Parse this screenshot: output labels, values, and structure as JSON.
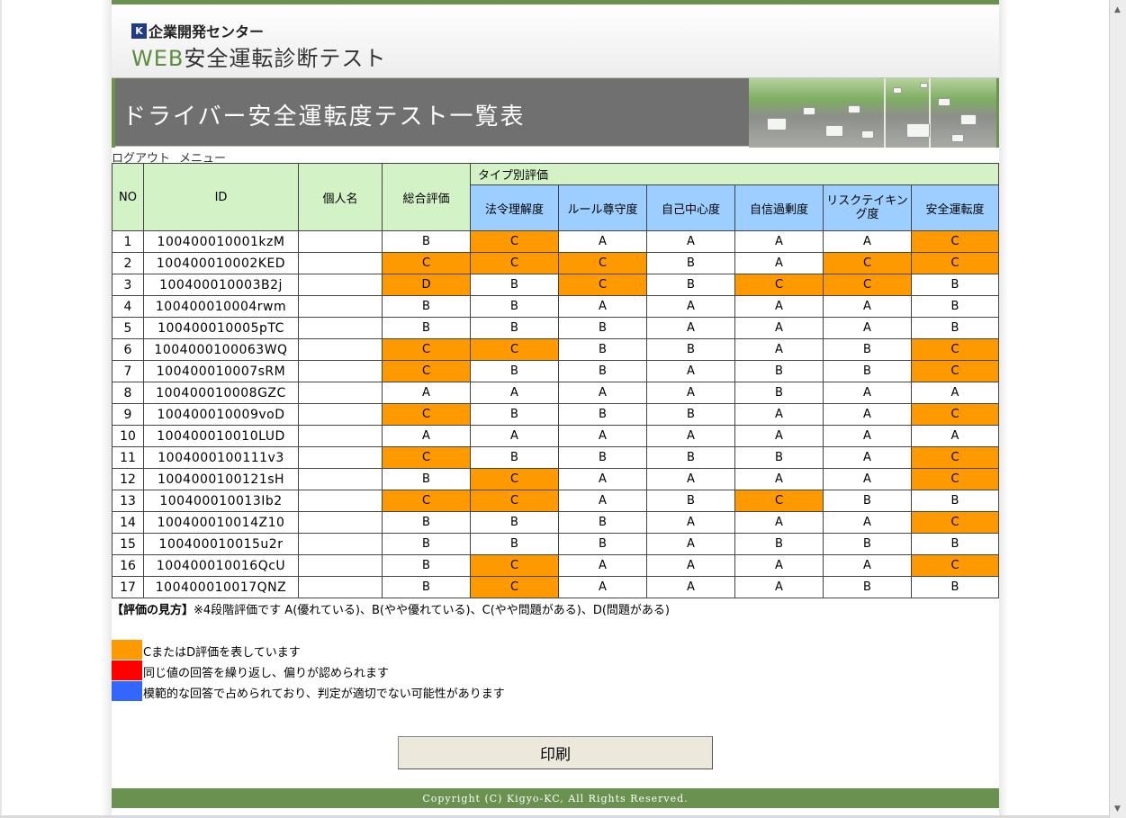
{
  "header": {
    "company": "企業開発センター",
    "logo_mark": "K",
    "app_title_web": "WEB",
    "app_title_rest": "安全運転診断テスト"
  },
  "banner": {
    "title": "ドライバー安全運転度テスト一覧表"
  },
  "links": {
    "logout": "ログアウト",
    "menu": "メニュー"
  },
  "table": {
    "headers": {
      "no": "NO",
      "id": "ID",
      "name": "個人名",
      "overall": "総合評価",
      "type_group": "タイプ別評価",
      "types": [
        "法令理解度",
        "ルール尊守度",
        "自己中心度",
        "自信過剰度",
        "リスクテイキング度",
        "安全運転度"
      ]
    },
    "rows": [
      {
        "no": "1",
        "id": "100400010001kzM",
        "name": "",
        "overall": "B",
        "types": [
          "C",
          "A",
          "A",
          "A",
          "A",
          "C"
        ]
      },
      {
        "no": "2",
        "id": "100400010002KED",
        "name": "",
        "overall": "C",
        "types": [
          "C",
          "C",
          "B",
          "A",
          "C",
          "C"
        ]
      },
      {
        "no": "3",
        "id": "100400010003B2j",
        "name": "",
        "overall": "D",
        "types": [
          "B",
          "C",
          "B",
          "C",
          "C",
          "B"
        ]
      },
      {
        "no": "4",
        "id": "100400010004rwm",
        "name": "",
        "overall": "B",
        "types": [
          "B",
          "A",
          "A",
          "A",
          "A",
          "B"
        ]
      },
      {
        "no": "5",
        "id": "100400010005pTC",
        "name": "",
        "overall": "B",
        "types": [
          "B",
          "B",
          "A",
          "A",
          "A",
          "B"
        ]
      },
      {
        "no": "6",
        "id": "1004000100063WQ",
        "name": "",
        "overall": "C",
        "types": [
          "C",
          "B",
          "B",
          "A",
          "B",
          "C"
        ]
      },
      {
        "no": "7",
        "id": "100400010007sRM",
        "name": "",
        "overall": "C",
        "types": [
          "B",
          "B",
          "A",
          "B",
          "B",
          "C"
        ]
      },
      {
        "no": "8",
        "id": "100400010008GZC",
        "name": "",
        "overall": "A",
        "types": [
          "A",
          "A",
          "A",
          "B",
          "A",
          "A"
        ]
      },
      {
        "no": "9",
        "id": "100400010009voD",
        "name": "",
        "overall": "C",
        "types": [
          "B",
          "B",
          "B",
          "A",
          "A",
          "C"
        ]
      },
      {
        "no": "10",
        "id": "100400010010LUD",
        "name": "",
        "overall": "A",
        "types": [
          "A",
          "A",
          "A",
          "A",
          "A",
          "A"
        ]
      },
      {
        "no": "11",
        "id": "1004000100111v3",
        "name": "",
        "overall": "C",
        "types": [
          "B",
          "B",
          "B",
          "B",
          "A",
          "C"
        ]
      },
      {
        "no": "12",
        "id": "1004000100121sH",
        "name": "",
        "overall": "B",
        "types": [
          "C",
          "A",
          "A",
          "A",
          "A",
          "C"
        ]
      },
      {
        "no": "13",
        "id": "100400010013Ib2",
        "name": "",
        "overall": "C",
        "types": [
          "C",
          "A",
          "B",
          "C",
          "B",
          "B"
        ]
      },
      {
        "no": "14",
        "id": "100400010014Z10",
        "name": "",
        "overall": "B",
        "types": [
          "B",
          "B",
          "A",
          "A",
          "A",
          "C"
        ]
      },
      {
        "no": "15",
        "id": "100400010015u2r",
        "name": "",
        "overall": "B",
        "types": [
          "B",
          "B",
          "A",
          "B",
          "B",
          "B"
        ]
      },
      {
        "no": "16",
        "id": "100400010016QcU",
        "name": "",
        "overall": "B",
        "types": [
          "C",
          "A",
          "A",
          "A",
          "A",
          "C"
        ]
      },
      {
        "no": "17",
        "id": "100400010017QNZ",
        "name": "",
        "overall": "B",
        "types": [
          "C",
          "A",
          "A",
          "A",
          "B",
          "B"
        ]
      }
    ]
  },
  "legend": {
    "bold_prefix": "【評価の見方】",
    "text": "※4段階評価です A(優れている)、B(やや優れている)、C(やや問題がある)、D(問題がある)",
    "items": [
      {
        "color": "#ff9900",
        "label": "CまたはD評価を表しています"
      },
      {
        "color": "#ff0000",
        "label": "同じ値の回答を繰り返し、偏りが認められます"
      },
      {
        "color": "#3366ff",
        "label": "模範的な回答で占められており、判定が適切でない可能性があります"
      }
    ]
  },
  "colors": {
    "accent_green": "#6a9150",
    "header_green": "#d3f2c6",
    "header_blue": "#9ccfff",
    "grade_highlight": "#ff9900"
  },
  "print_label": "印刷",
  "footer": "Copyright (C) Kigyo-KC, All Rights Reserved."
}
